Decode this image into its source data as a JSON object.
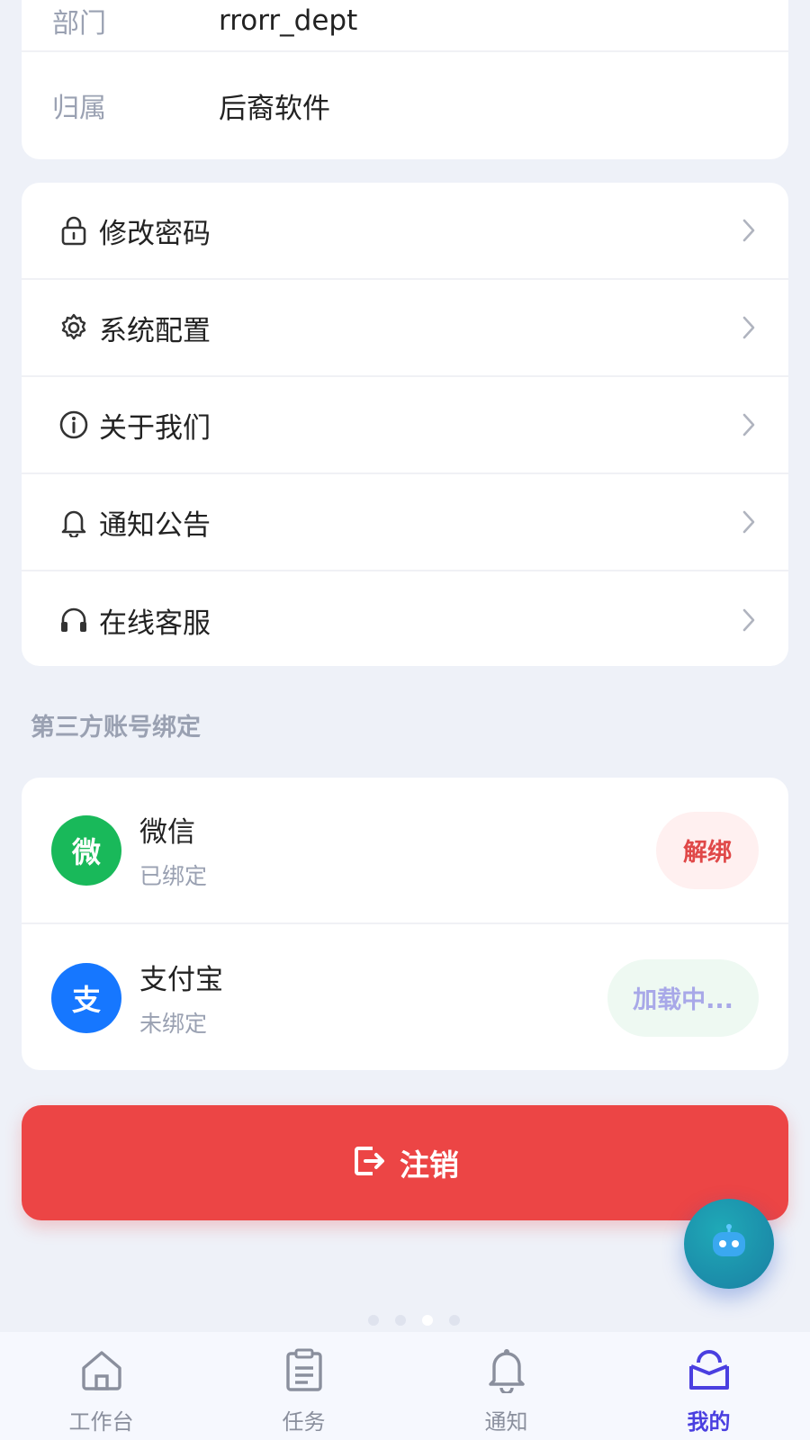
{
  "info": {
    "rows": [
      {
        "label": "部门",
        "value": "rrorr_dept"
      },
      {
        "label": "归属",
        "value": "后裔软件"
      }
    ]
  },
  "menu": {
    "items": [
      {
        "label": "修改密码",
        "icon": "lock-icon"
      },
      {
        "label": "系统配置",
        "icon": "gear-icon"
      },
      {
        "label": "关于我们",
        "icon": "info-icon"
      },
      {
        "label": "通知公告",
        "icon": "bell-icon"
      },
      {
        "label": "在线客服",
        "icon": "headset-icon"
      }
    ]
  },
  "binding": {
    "title": "第三方账号绑定",
    "accounts": [
      {
        "avatar_char": "微",
        "name": "微信",
        "status": "已绑定",
        "action": "解绑",
        "color": "#19b95a"
      },
      {
        "avatar_char": "支",
        "name": "支付宝",
        "status": "未绑定",
        "action": "加载中...",
        "color": "#1677ff"
      }
    ]
  },
  "logout": {
    "label": "注销"
  },
  "tabs": [
    {
      "label": "工作台",
      "icon": "home-icon",
      "active": false
    },
    {
      "label": "任务",
      "icon": "clipboard-icon",
      "active": false
    },
    {
      "label": "通知",
      "icon": "bell-icon",
      "active": false
    },
    {
      "label": "我的",
      "icon": "user-icon",
      "active": true
    }
  ],
  "colors": {
    "background": "#eef1f8",
    "accent": "#4a3fe0",
    "danger": "#ec4545",
    "wechat": "#19b95a",
    "alipay": "#1677ff"
  }
}
